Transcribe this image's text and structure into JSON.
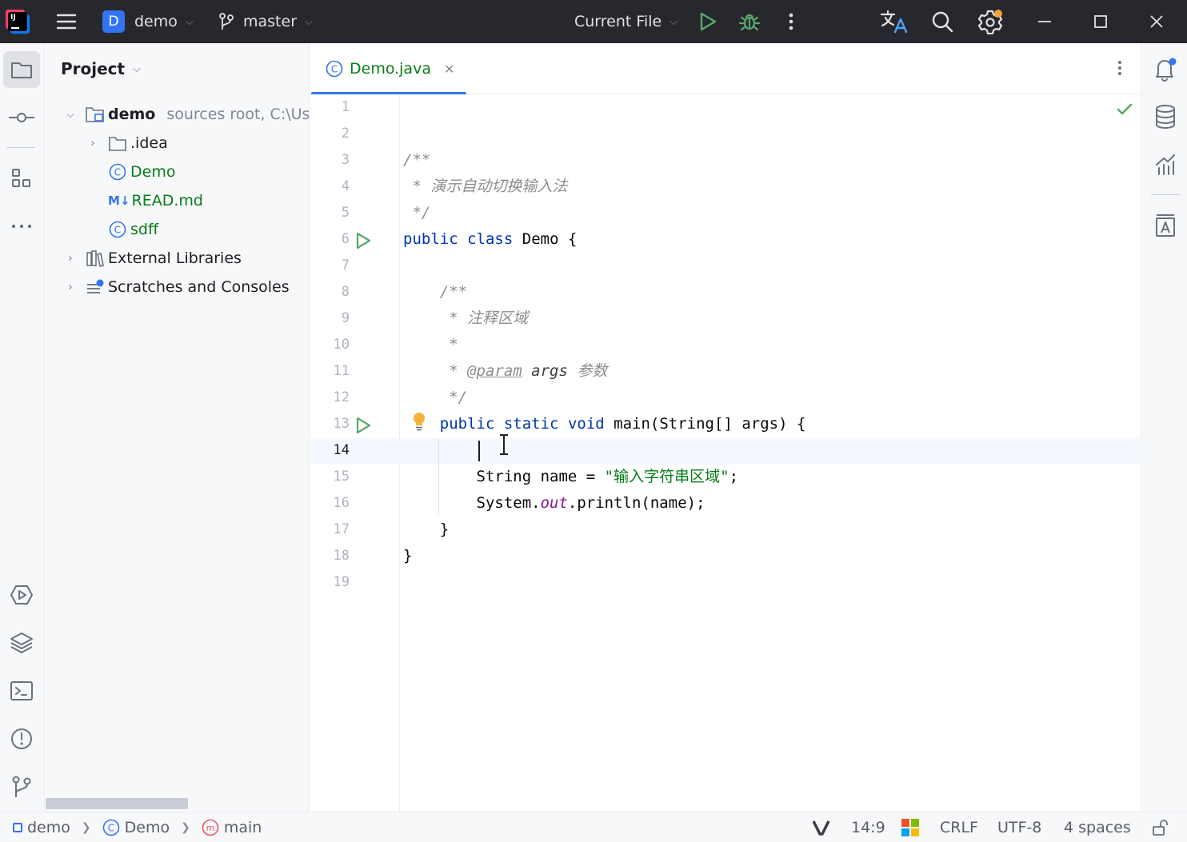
{
  "titlebar": {
    "logo_text": "IJ",
    "project_badge": "D",
    "project_name": "demo",
    "branch": "master",
    "run_config": "Current File"
  },
  "project_panel": {
    "title": "Project",
    "root": {
      "name": "demo",
      "hint": "sources root,  C:\\Use"
    },
    "children": [
      {
        "name": ".idea",
        "type": "folder"
      },
      {
        "name": "Demo",
        "type": "class"
      },
      {
        "name": "READ.md",
        "type": "markdown",
        "icon_text": "M↓"
      },
      {
        "name": "sdff",
        "type": "class"
      }
    ],
    "external_libraries": "External Libraries",
    "scratches": "Scratches and Consoles"
  },
  "editor": {
    "tab": {
      "label": "Demo.java"
    },
    "line_numbers": [
      "1",
      "2",
      "3",
      "4",
      "5",
      "6",
      "7",
      "8",
      "9",
      "10",
      "11",
      "12",
      "13",
      "14",
      "15",
      "16",
      "17",
      "18",
      "19"
    ],
    "current_line": "14",
    "code": {
      "l3": "/**",
      "l4": " * 演示自动切换输入法",
      "l5": " */",
      "l6_kw1": "public",
      "l6_kw2": "class",
      "l6_rest": "Demo {",
      "l8": "    /**",
      "l9": "     * 注释区域",
      "l10": "     *",
      "l11_pre": "     * ",
      "l11_tag": "@param",
      "l11_arg": "args",
      "l11_desc": "参数",
      "l12": "     */",
      "l13_kw1": "public",
      "l13_kw2": "static",
      "l13_kw3": "void",
      "l13_rest": "main(String[] args) {",
      "l15_pre": "String name = ",
      "l15_str": "\"输入字符串区域\"",
      "l15_post": ";",
      "l16_pre": "System.",
      "l16_field": "out",
      "l16_post": ".println(name);",
      "l17": "}",
      "l18": "}"
    }
  },
  "status_bar": {
    "breadcrumb_project": "demo",
    "breadcrumb_class": "Demo",
    "breadcrumb_method": "main",
    "position": "14:9",
    "line_separator": "CRLF",
    "encoding": "UTF-8",
    "indent": "4 spaces"
  },
  "colors": {
    "accent": "#3574f0",
    "run_green": "#59a869",
    "keyword": "#0033b3",
    "string": "#067d17",
    "comment": "#8c8c8c",
    "field": "#871094"
  }
}
